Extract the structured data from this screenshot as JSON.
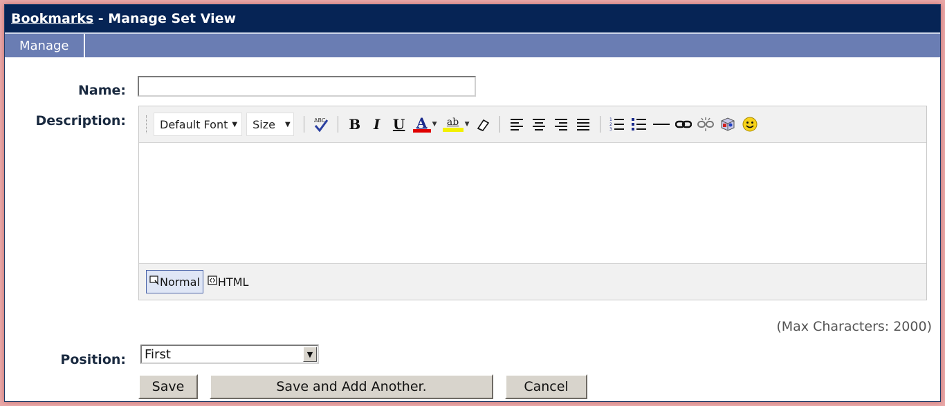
{
  "title": {
    "breadcrumb": "Bookmarks",
    "separator": " - ",
    "page": "Manage Set View"
  },
  "tabs": [
    {
      "label": "Manage"
    }
  ],
  "form": {
    "name_label": "Name:",
    "name_value": "",
    "description_label": "Description:",
    "position_label": "Position:",
    "position_value": "First",
    "max_chars": "(Max Characters: 2000)"
  },
  "editor": {
    "font_dropdown": "Default Font",
    "size_dropdown": "Size",
    "bold": "B",
    "italic": "I",
    "underline": "U",
    "font_color": "A",
    "highlight": "ab",
    "modes": {
      "normal": "Normal",
      "html": "HTML"
    }
  },
  "buttons": {
    "save": "Save",
    "save_add": "Save and Add Another.",
    "cancel": "Cancel"
  },
  "colors": {
    "titlebar": "#062455",
    "tabbar": "#6a7db3",
    "font_color_bar": "#e00000",
    "highlight_bar": "#f2f000"
  }
}
